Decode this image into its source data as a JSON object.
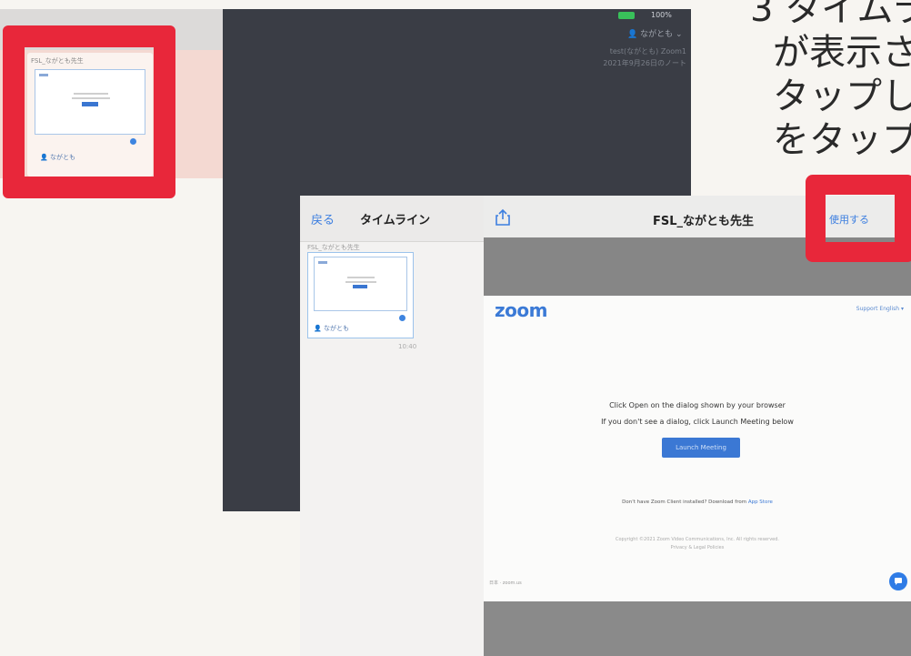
{
  "instruction": {
    "lines": [
      "3 タイムラ",
      "が表示さ",
      "タップし",
      "をタップ"
    ]
  },
  "thumbnail": {
    "title": "FSL_ながとも先生",
    "user": "ながとも"
  },
  "background_ipad": {
    "status": "100%",
    "user": "ながとも",
    "meta_line1": "test(ながとも) Zoom1",
    "meta_line2": "2021年9月26日のノート"
  },
  "sidebar": {
    "back_label": "戻る",
    "title": "タイムライン",
    "item_title": "FSL_ながとも先生",
    "item_user": "ながとも",
    "item_time": "10:40"
  },
  "viewer": {
    "title": "FSL_ながとも先生",
    "use_button": "使用する"
  },
  "zoom_page": {
    "logo": "zoom",
    "nav": "Support   English ▾",
    "line1": "Click Open on the dialog shown by your browser",
    "line2": "If you don't see a dialog, click Launch Meeting below",
    "launch_button": "Launch Meeting",
    "download_text": "Don't have Zoom Client installed? Download from ",
    "download_link": "App Store",
    "copyright": "Copyright ©2021 Zoom Video Communications, Inc. All rights reserved.",
    "privacy": "Privacy & Legal Policies",
    "lang": "日本 · zoom.us"
  },
  "colors": {
    "accent": "#3d7fe0",
    "highlight": "#e8273a",
    "zoom_blue": "#3b78d4"
  }
}
